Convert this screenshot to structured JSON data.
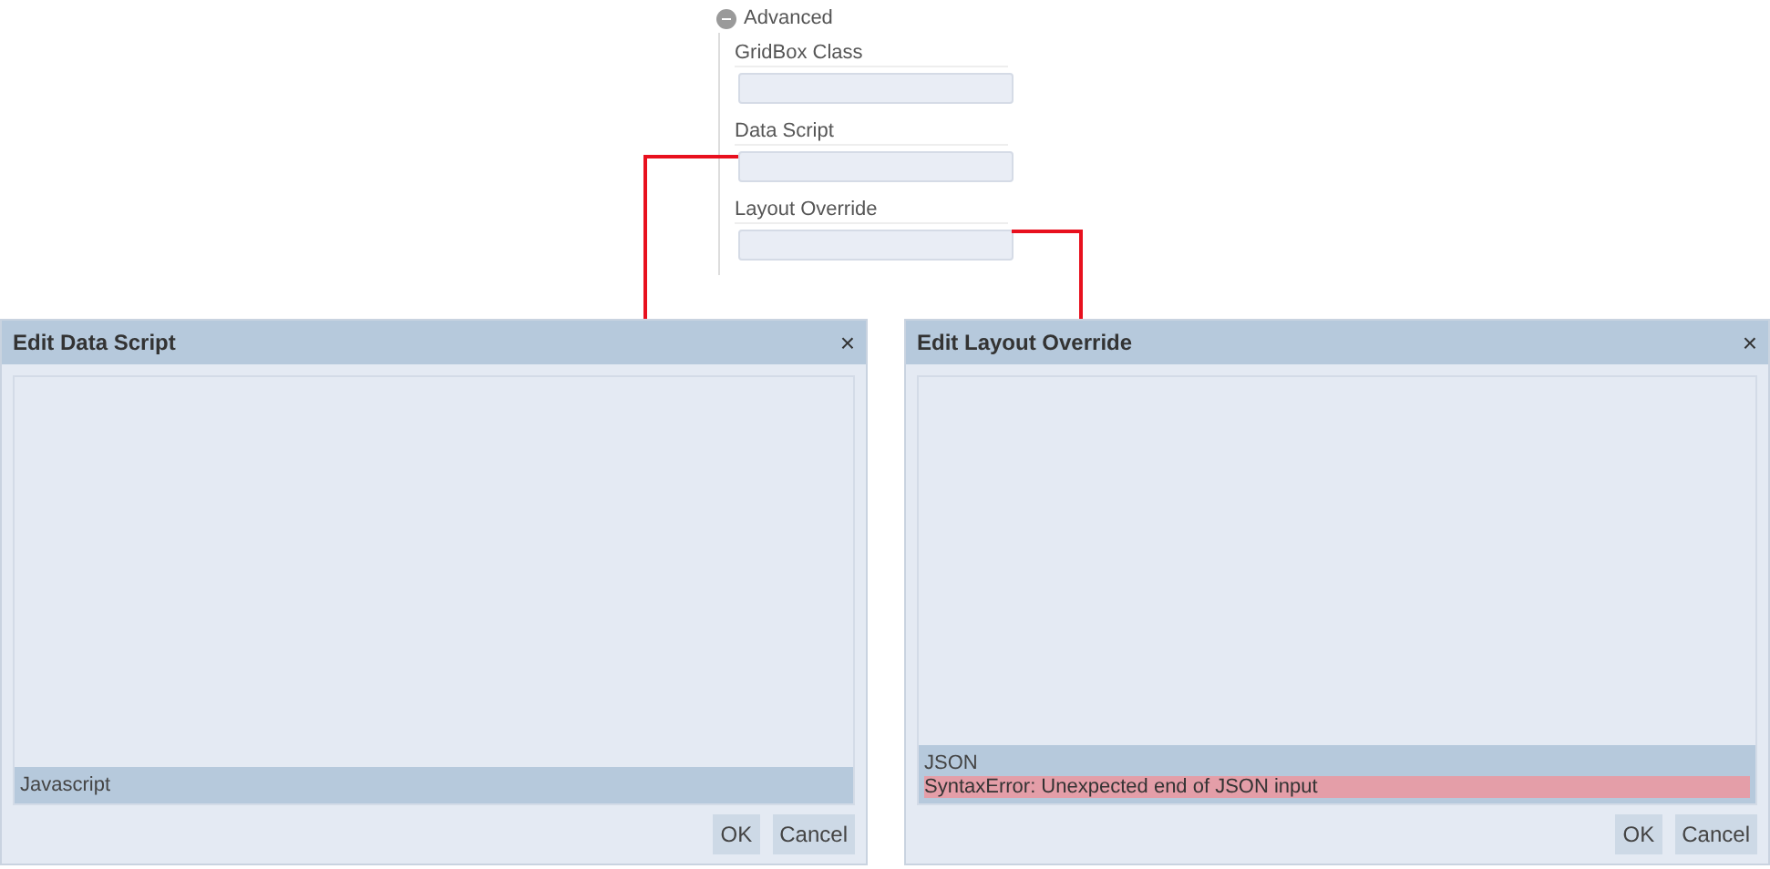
{
  "advanced_section": {
    "title": "Advanced",
    "expanded": true,
    "fields": [
      {
        "label": "GridBox Class"
      },
      {
        "label": "Data Script"
      },
      {
        "label": "Layout Override"
      }
    ]
  },
  "dialogs": [
    {
      "title": "Edit Data Script",
      "close": "×",
      "mode": "Javascript",
      "buttons": [
        "OK",
        "Cancel"
      ]
    },
    {
      "title": "Edit Layout Override",
      "close": "×",
      "mode": "JSON",
      "error": "SyntaxError: Unexpected end of JSON input",
      "buttons": [
        "OK",
        "Cancel"
      ]
    }
  ]
}
